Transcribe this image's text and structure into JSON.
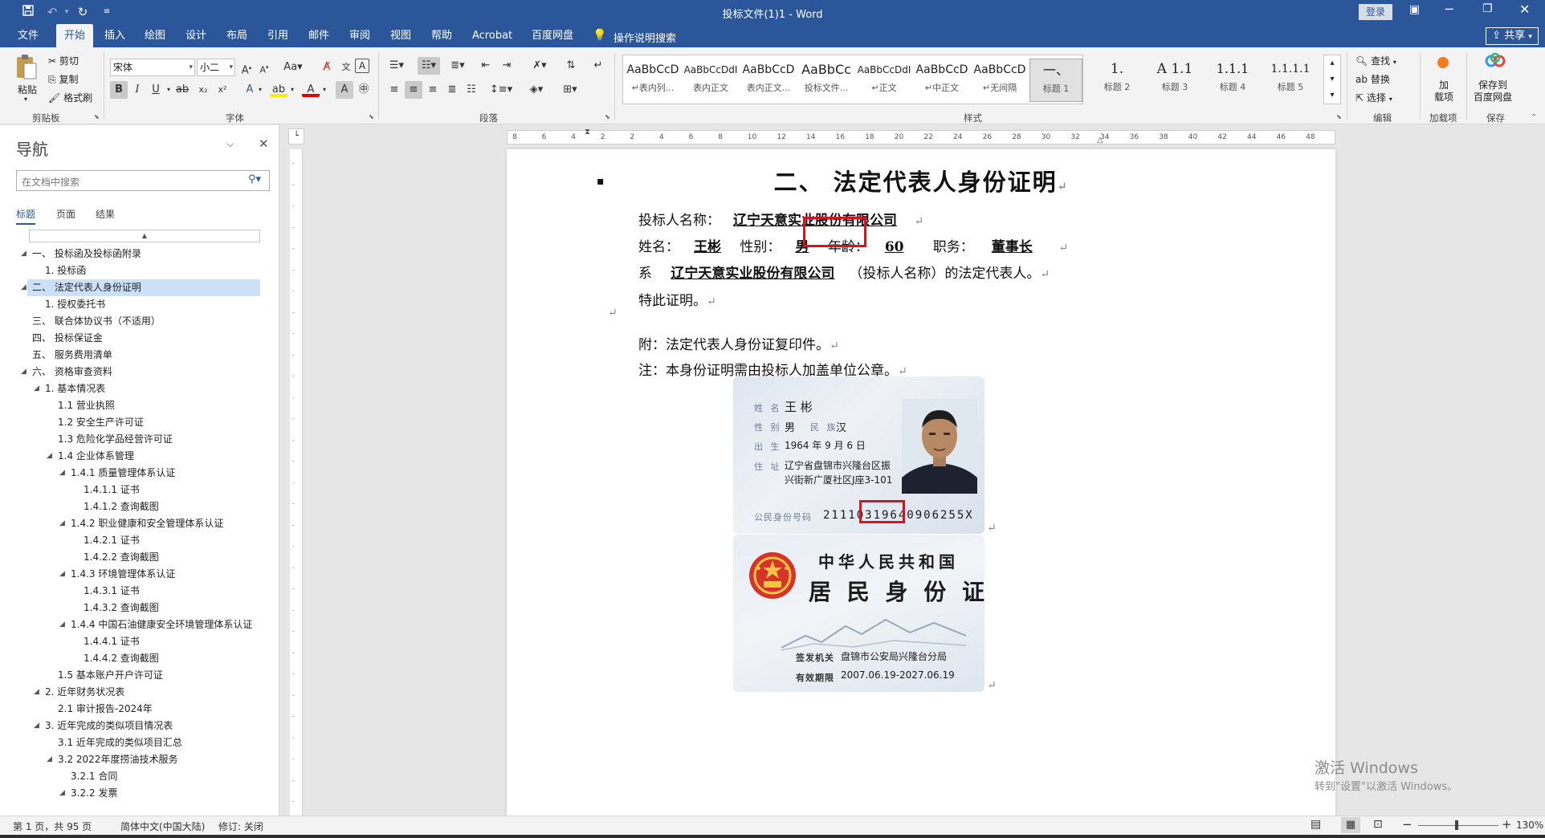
{
  "window": {
    "title": "投标文件(1)1 - Word",
    "login_label": "登录"
  },
  "quick_access": {
    "save_icon": "save-icon",
    "undo_icon": "undo-icon",
    "redo_icon": "redo-icon",
    "customize_icon": "chevron-down-icon"
  },
  "tabs": [
    "文件",
    "开始",
    "插入",
    "绘图",
    "设计",
    "布局",
    "引用",
    "邮件",
    "审阅",
    "视图",
    "帮助",
    "Acrobat",
    "百度网盘"
  ],
  "active_tab": "开始",
  "tell_me": "操作说明搜索",
  "share_label": "共享",
  "ribbon": {
    "clipboard": {
      "paste": "粘贴",
      "cut": "剪切",
      "copy": "复制",
      "format_painter": "格式刷",
      "group": "剪贴板"
    },
    "font": {
      "name": "宋体",
      "size": "小二",
      "group": "字体"
    },
    "paragraph": {
      "group": "段落"
    },
    "styles": {
      "group": "样式",
      "items": [
        {
          "preview": "AaBbCcD",
          "name": "↵表内列..."
        },
        {
          "preview": "AaBbCcDdI",
          "name": "表内正文"
        },
        {
          "preview": "AaBbCcD",
          "name": "表内正文..."
        },
        {
          "preview": "AaBbCc",
          "name": "投标文件..."
        },
        {
          "preview": "AaBbCcDdI",
          "name": "↵正文"
        },
        {
          "preview": "AaBbCcD",
          "name": "↵中正文"
        },
        {
          "preview": "AaBbCcD",
          "name": "↵无间隔"
        },
        {
          "preview": "一、",
          "name": "标题 1"
        },
        {
          "preview": "1.",
          "name": "标题 2"
        },
        {
          "preview": "A 1.1",
          "name": "标题 3"
        },
        {
          "preview": "1.1.1",
          "name": "标题 4"
        },
        {
          "preview": "1.1.1.1",
          "name": "标题 5"
        }
      ]
    },
    "editing": {
      "find": "查找",
      "replace": "替换",
      "select": "选择",
      "group": "编辑"
    },
    "addin": {
      "label": "加\n载项",
      "group": "加载项"
    },
    "save_baidu": {
      "label": "保存到\n百度网盘",
      "group": "保存"
    }
  },
  "nav": {
    "title": "导航",
    "search_placeholder": "在文档中搜索",
    "tabs": [
      "标题",
      "页面",
      "结果"
    ],
    "items": [
      {
        "text": "一、 投标函及投标函附录",
        "level": 0,
        "caret": true
      },
      {
        "text": "1. 投标函",
        "level": 1,
        "caret": false
      },
      {
        "text": "二、 法定代表人身份证明",
        "level": 0,
        "caret": true,
        "selected": true
      },
      {
        "text": "1. 授权委托书",
        "level": 1,
        "caret": false
      },
      {
        "text": "三、 联合体协议书（不适用）",
        "level": 0,
        "caret": false
      },
      {
        "text": "四、 投标保证金",
        "level": 0,
        "caret": false
      },
      {
        "text": "五、 服务费用清单",
        "level": 0,
        "caret": false
      },
      {
        "text": "六、 资格审查资料",
        "level": 0,
        "caret": true
      },
      {
        "text": "1. 基本情况表",
        "level": 1,
        "caret": true
      },
      {
        "text": "1.1 营业执照",
        "level": 2,
        "caret": false
      },
      {
        "text": "1.2 安全生产许可证",
        "level": 2,
        "caret": false
      },
      {
        "text": "1.3 危险化学品经营许可证",
        "level": 2,
        "caret": false
      },
      {
        "text": "1.4 企业体系管理",
        "level": 2,
        "caret": true
      },
      {
        "text": "1.4.1 质量管理体系认证",
        "level": 3,
        "caret": true
      },
      {
        "text": "1.4.1.1 证书",
        "level": 4,
        "caret": false
      },
      {
        "text": "1.4.1.2 查询截图",
        "level": 4,
        "caret": false
      },
      {
        "text": "1.4.2 职业健康和安全管理体系认证",
        "level": 3,
        "caret": true
      },
      {
        "text": "1.4.2.1 证书",
        "level": 4,
        "caret": false
      },
      {
        "text": "1.4.2.2 查询截图",
        "level": 4,
        "caret": false
      },
      {
        "text": "1.4.3 环境管理体系认证",
        "level": 3,
        "caret": true
      },
      {
        "text": "1.4.3.1 证书",
        "level": 4,
        "caret": false
      },
      {
        "text": "1.4.3.2 查询截图",
        "level": 4,
        "caret": false
      },
      {
        "text": "1.4.4 中国石油健康安全环境管理体系认证",
        "level": 3,
        "caret": true
      },
      {
        "text": "1.4.4.1 证书",
        "level": 4,
        "caret": false
      },
      {
        "text": "1.4.4.2 查询截图",
        "level": 4,
        "caret": false
      },
      {
        "text": "1.5 基本账户开户许可证",
        "level": 2,
        "caret": false
      },
      {
        "text": "2. 近年财务状况表",
        "level": 1,
        "caret": true
      },
      {
        "text": "2.1 审计报告-2024年",
        "level": 2,
        "caret": false
      },
      {
        "text": "3. 近年完成的类似项目情况表",
        "level": 1,
        "caret": true
      },
      {
        "text": "3.1 近年完成的类似项目汇总",
        "level": 2,
        "caret": false
      },
      {
        "text": "3.2 2022年度捞油技术服务",
        "level": 2,
        "caret": true
      },
      {
        "text": "3.2.1 合同",
        "level": 3,
        "caret": false
      },
      {
        "text": "3.2.2 发票",
        "level": 3,
        "caret": true
      }
    ]
  },
  "ruler_numbers": [
    "8",
    "6",
    "4",
    "2",
    "2",
    "4",
    "6",
    "8",
    "10",
    "12",
    "14",
    "16",
    "18",
    "20",
    "22",
    "24",
    "26",
    "28",
    "30",
    "32",
    "34",
    "36",
    "38",
    "40",
    "42",
    "44",
    "46",
    "48"
  ],
  "document": {
    "heading": "二、 法定代表人身份证明",
    "bidder_label": "投标人名称：",
    "bidder_value": "辽宁天意实业股份有限公司",
    "name_label": "姓名：",
    "name_value": "王彬",
    "gender_label": "性别：",
    "gender_value": "男",
    "age_label": "年龄：",
    "age_value": "60",
    "title_label": "职务：",
    "title_value": "董事长",
    "xi_label": "系",
    "xi_company": "辽宁天意实业股份有限公司",
    "xi_suffix": "（投标人名称）的法定代表人。",
    "certify": "特此证明。",
    "attach": "附：法定代表人身份证复印件。",
    "note": "注：本身份证明需由投标人加盖单位公章。"
  },
  "idcard_front": {
    "name_label": "姓 名",
    "name": "王 彬",
    "gender_label": "性 别",
    "gender": "男",
    "ethnic_label": "民 族",
    "ethnic": "汉",
    "birth_label": "出 生",
    "birth": "1964  年  9  月  6  日",
    "address_label": "住 址",
    "address_line1": "辽宁省盘锦市兴隆台区振",
    "address_line2": "兴街新广厦社区J座3-101",
    "id_label": "公民身份号码",
    "id_number": "21110319640906255X"
  },
  "idcard_back": {
    "title1": "中华人民共和国",
    "title2": "居 民 身 份 证",
    "authority_label": "签发机关",
    "authority": "盘锦市公安局兴隆台分局",
    "validity_label": "有效期限",
    "validity": "2007.06.19-2027.06.19"
  },
  "watermark": {
    "line1": "激活 Windows",
    "line2": "转到\"设置\"以激活 Windows。"
  },
  "status": {
    "page": "第 1 页，共 95 页",
    "language": "简体中文(中国大陆)",
    "track": "修订: 关闭",
    "zoom": "130%"
  },
  "colors": {
    "brand": "#2b579a",
    "highlight_box": "#d4151f",
    "nav_selected": "#cce0f7"
  }
}
